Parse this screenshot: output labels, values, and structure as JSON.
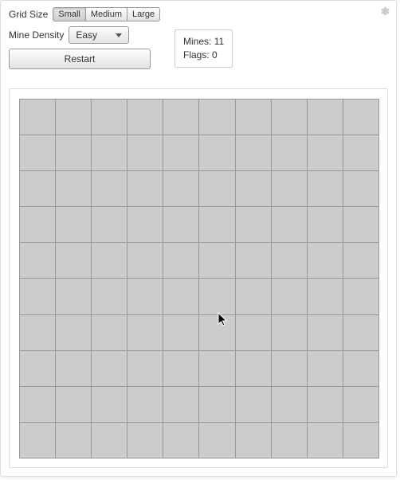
{
  "controls": {
    "grid_size_label": "Grid Size",
    "grid_size_options": [
      "Small",
      "Medium",
      "Large"
    ],
    "grid_size_selected": 0,
    "mine_density_label": "Mine Density",
    "mine_density_selected": "Easy",
    "restart_label": "Restart"
  },
  "status": {
    "mines_label": "Mines:",
    "mines_value": "11",
    "flags_label": "Flags:",
    "flags_value": "0"
  },
  "board": {
    "rows": 10,
    "cols": 10
  },
  "icons": {
    "gear": "gear-icon"
  }
}
